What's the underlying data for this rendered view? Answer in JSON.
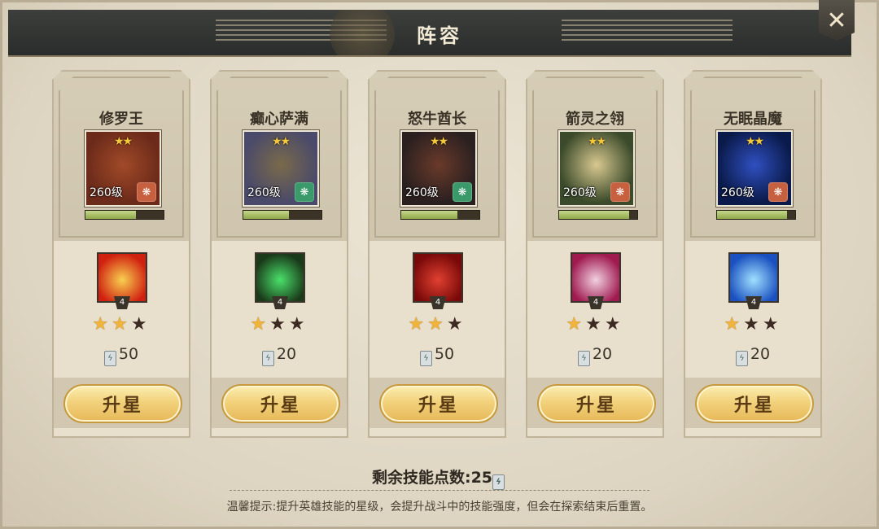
{
  "window": {
    "title": "阵容",
    "close_label": "✕"
  },
  "heroes": [
    {
      "name": "修罗王",
      "level": "260级",
      "hp_fraction": 0.65,
      "element": "fire",
      "element_color": "#c7603f",
      "skill_level": "4",
      "skill_stars": 2,
      "cost": "50",
      "button": "升星",
      "portrait_colors": [
        "#6b2a1a",
        "#a14a28"
      ],
      "skill_colors": [
        "#f8d050",
        "#d02010"
      ]
    },
    {
      "name": "癫心萨满",
      "level": "260级",
      "hp_fraction": 0.58,
      "element": "nature",
      "element_color": "#3a9a6a",
      "skill_level": "4",
      "skill_stars": 1,
      "cost": "20",
      "button": "升星",
      "portrait_colors": [
        "#4a4a6a",
        "#7a6a4a"
      ],
      "skill_colors": [
        "#4ae06a",
        "#1a3a1a"
      ]
    },
    {
      "name": "怒牛酋长",
      "level": "260级",
      "hp_fraction": 0.72,
      "element": "nature",
      "element_color": "#3a9a6a",
      "skill_level": "4",
      "skill_stars": 2,
      "cost": "50",
      "button": "升星",
      "portrait_colors": [
        "#2a2020",
        "#6a3a2a"
      ],
      "skill_colors": [
        "#e04030",
        "#7a0a0a"
      ]
    },
    {
      "name": "箭灵之翎",
      "level": "260级",
      "hp_fraction": 0.9,
      "element": "fire",
      "element_color": "#c7603f",
      "skill_level": "4",
      "skill_stars": 1,
      "cost": "20",
      "button": "升星",
      "portrait_colors": [
        "#3a4a2a",
        "#d8c890"
      ],
      "skill_colors": [
        "#f0d0e0",
        "#a01a50"
      ]
    },
    {
      "name": "无眠晶魔",
      "level": "260级",
      "hp_fraction": 0.9,
      "element": "fire",
      "element_color": "#c7603f",
      "skill_level": "4",
      "skill_stars": 1,
      "cost": "20",
      "button": "升星",
      "portrait_colors": [
        "#0a1a4a",
        "#3050c0"
      ],
      "skill_colors": [
        "#a0e0ff",
        "#1a50c0"
      ]
    }
  ],
  "footer": {
    "points_label": "剩余技能点数:25",
    "tip": "温馨提示:提升英雄技能的星级，会提升战斗中的技能强度，但会在探索结束后重置。"
  }
}
